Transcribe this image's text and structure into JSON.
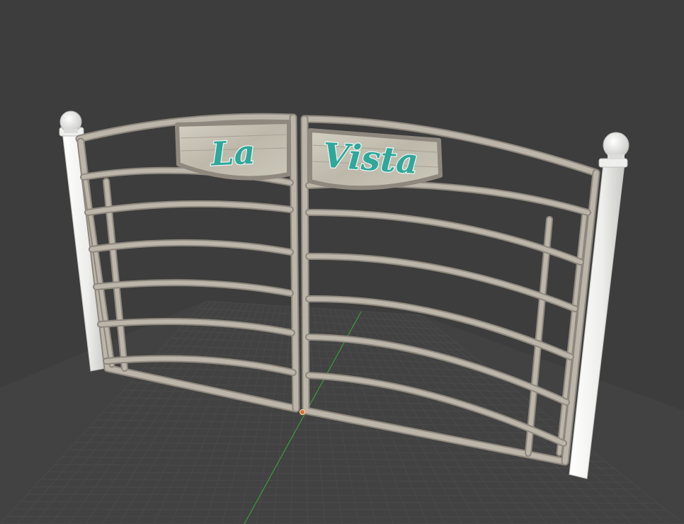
{
  "viewport": {
    "background_color": "#3d3d3d",
    "grid_color": "#4a4a4a",
    "y_axis_color": "#3c9a3c",
    "origin_color": "#d2722e"
  },
  "model": {
    "sign_left_text": "La",
    "sign_right_text": "Vista",
    "sign_text_color": "#2fa79a",
    "sign_board_color": "#c8c4b6",
    "frame_color": "#b9b2a7",
    "post_color": "#f1f1ef"
  }
}
